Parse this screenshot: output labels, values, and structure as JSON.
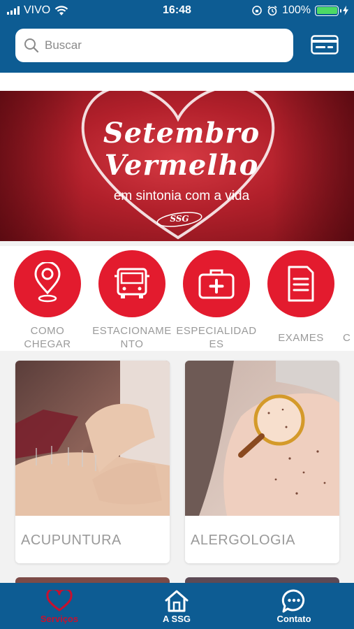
{
  "status_bar": {
    "carrier": "VIVO",
    "time": "16:48",
    "battery": "100%"
  },
  "search": {
    "placeholder": "Buscar"
  },
  "banner": {
    "title_line1": "Setembro",
    "title_line2": "Vermelho",
    "subtitle": "em sintonia com a vida",
    "logo_text": "SSG"
  },
  "categories": [
    {
      "label_line1": "COMO",
      "label_line2": "CHEGAR",
      "icon": "map-pin-icon"
    },
    {
      "label_line1": "ESTACIONAME",
      "label_line2": "NTO",
      "icon": "bus-icon"
    },
    {
      "label_line1": "ESPECIALIDAD",
      "label_line2": "ES",
      "icon": "medical-kit-icon"
    },
    {
      "label_line1": "EXAMES",
      "label_line2": "",
      "icon": "document-icon"
    },
    {
      "label_line1": "C",
      "label_line2": ""
    }
  ],
  "cards": [
    {
      "title": "ACUPUNTURA"
    },
    {
      "title": "ALERGOLOGIA"
    }
  ],
  "tabs": [
    {
      "label": "Serviços",
      "icon": "heart-icon"
    },
    {
      "label": "A SSG",
      "icon": "home-icon"
    },
    {
      "label": "Contato",
      "icon": "chat-icon"
    }
  ],
  "colors": {
    "primary": "#0d5c93",
    "accent": "#e31b2e",
    "active_tab": "#c8102e"
  }
}
